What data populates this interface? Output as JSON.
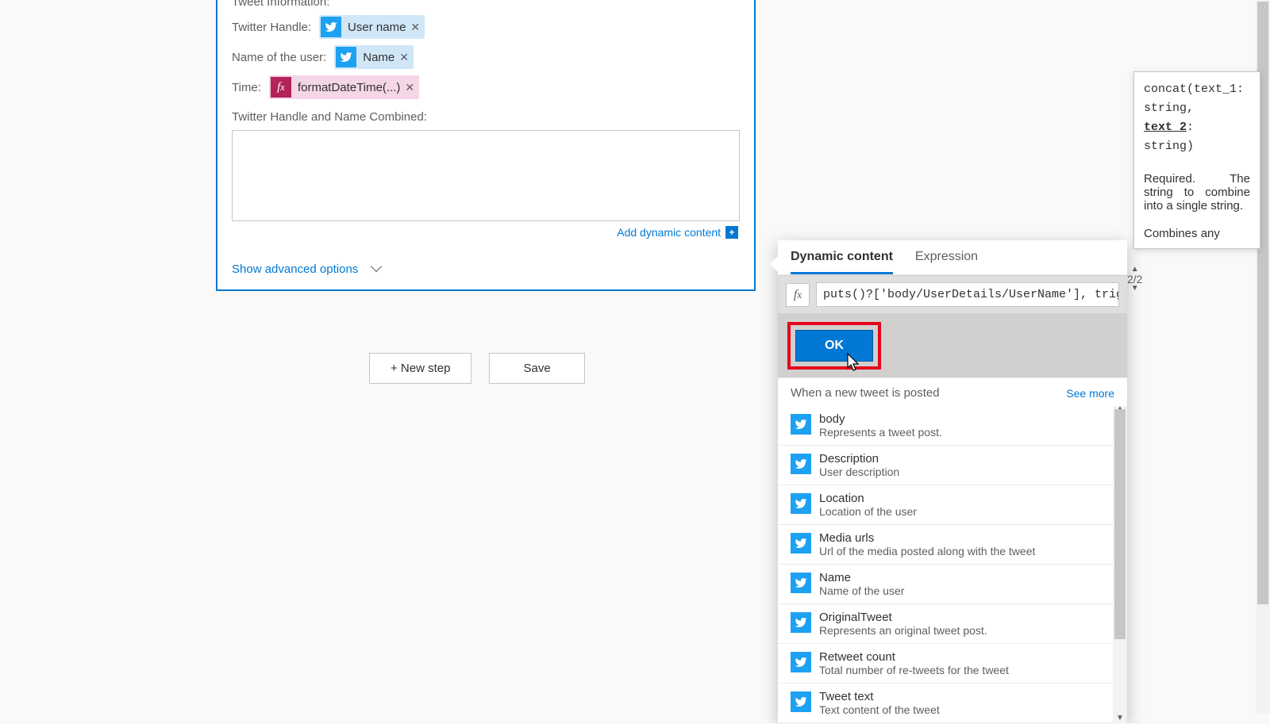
{
  "card": {
    "tweet_info_label": "Tweet Information:",
    "handle_label": "Twitter Handle:",
    "handle_token": "User name",
    "name_label": "Name of the user:",
    "name_token": "Name",
    "time_label": "Time:",
    "time_token": "formatDateTime(...)",
    "combined_label": "Twitter Handle and Name Combined:",
    "add_dynamic": "Add dynamic content",
    "show_advanced": "Show advanced options"
  },
  "buttons": {
    "new_step": "+ New step",
    "save": "Save"
  },
  "flyout": {
    "tab_dynamic": "Dynamic content",
    "tab_expression": "Expression",
    "fx_value": "puts()?['body/UserDetails/UserName'], trig",
    "ok": "OK",
    "section_title": "When a new tweet is posted",
    "see_more": "See more",
    "items": [
      {
        "title": "body",
        "desc": "Represents a tweet post."
      },
      {
        "title": "Description",
        "desc": "User description"
      },
      {
        "title": "Location",
        "desc": "Location of the user"
      },
      {
        "title": "Media urls",
        "desc": "Url of the media posted along with the tweet"
      },
      {
        "title": "Name",
        "desc": "Name of the user"
      },
      {
        "title": "OriginalTweet",
        "desc": "Represents an original tweet post."
      },
      {
        "title": "Retweet count",
        "desc": "Total number of re-tweets for the tweet"
      },
      {
        "title": "Tweet text",
        "desc": "Text content of the tweet"
      }
    ]
  },
  "tooltip": {
    "sig_pre": "concat(text_1: string, ",
    "sig_cur": "text_2",
    "sig_post": ": string)",
    "desc": "Required. The string to combine into a single string.",
    "extra": "Combines any",
    "counter": "2/2"
  }
}
